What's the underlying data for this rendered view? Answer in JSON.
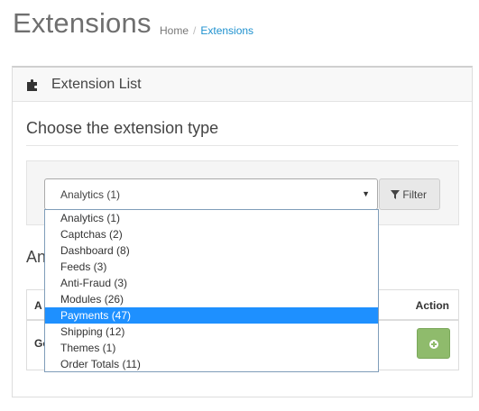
{
  "header": {
    "title": "Extensions"
  },
  "breadcrumb": {
    "home": "Home",
    "separator": "/",
    "current": "Extensions"
  },
  "panel": {
    "title": "Extension List"
  },
  "type_section": {
    "heading": "Choose the extension type"
  },
  "filter": {
    "selected": "Analytics (1)",
    "button_label": "Filter",
    "options": [
      "Analytics (1)",
      "Captchas (2)",
      "Dashboard (8)",
      "Feeds (3)",
      "Anti-Fraud (3)",
      "Modules (26)",
      "Payments (47)",
      "Shipping (12)",
      "Themes (1)",
      "Order Totals (11)"
    ],
    "highlighted_option": "Payments (47)"
  },
  "list": {
    "heading_fragment": "An",
    "columns": {
      "name_fragment": "A",
      "action": "Action"
    },
    "row_name_fragment": "Go"
  },
  "colors": {
    "accent": "#1e91cf",
    "highlight": "#1e90ff",
    "install": "#8fbb6c"
  }
}
